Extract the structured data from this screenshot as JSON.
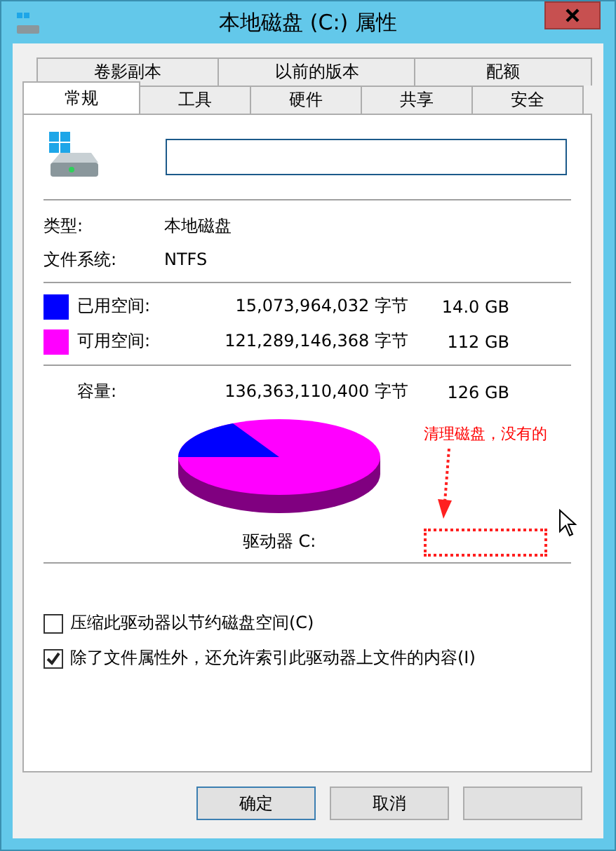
{
  "window": {
    "title": "本地磁盘 (C:) 属性"
  },
  "tabs_row_1": [
    {
      "label": "卷影副本",
      "selected": false
    },
    {
      "label": "以前的版本",
      "selected": false
    },
    {
      "label": "配额",
      "selected": false
    }
  ],
  "tabs_row_2": [
    {
      "label": "常规",
      "selected": true
    },
    {
      "label": "工具",
      "selected": false
    },
    {
      "label": "硬件",
      "selected": false
    },
    {
      "label": "共享",
      "selected": false
    },
    {
      "label": "安全",
      "selected": false
    }
  ],
  "info": [
    {
      "label": "类型:",
      "value": "本地磁盘"
    },
    {
      "label": "文件系统:",
      "value": "NTFS"
    }
  ],
  "space": [
    {
      "label": "已用空间:",
      "bytes": "15,073,964,032 字节",
      "size": "14.0 GB",
      "color": "#0000ff"
    },
    {
      "label": "可用空间:",
      "bytes": "121,289,146,368 字节",
      "size": "112 GB",
      "color": "#ff00ff"
    }
  ],
  "capacity": {
    "label": "容量:",
    "bytes": "136,363,110,400 字节",
    "size": "126 GB"
  },
  "drive_label": "驱动器 C:",
  "annotation": {
    "text": "清理磁盘，没有的"
  },
  "options": [
    {
      "label": "压缩此驱动器以节约磁盘空间(C)",
      "checked": false
    },
    {
      "label": "除了文件属性外，还允许索引此驱动器上文件的内容(I)",
      "checked": true
    }
  ],
  "buttons": [
    {
      "label": "确定",
      "kind": "default"
    },
    {
      "label": "取消",
      "kind": "normal"
    },
    {
      "kind": "hidden"
    }
  ]
}
